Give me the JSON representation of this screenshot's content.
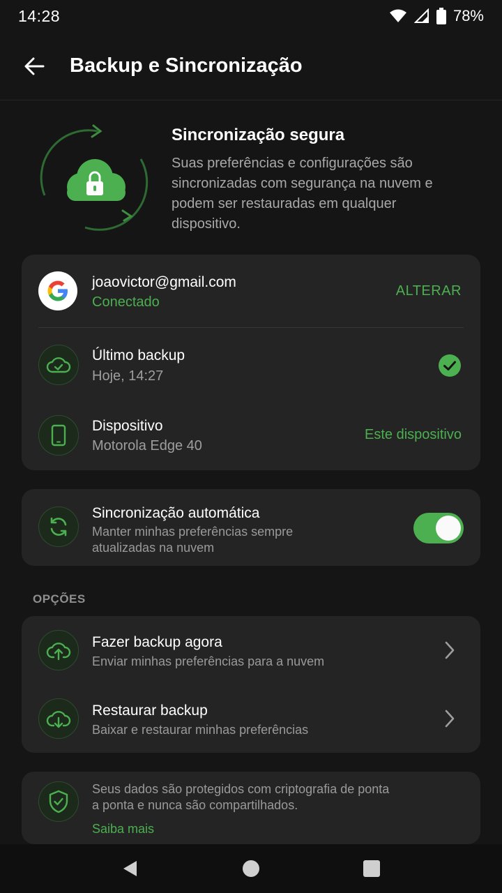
{
  "status_bar": {
    "time": "14:28",
    "battery": "78%",
    "icons": [
      "wifi-icon",
      "signal-icon",
      "battery-icon"
    ]
  },
  "app_bar": {
    "back_icon": "arrow-left-icon",
    "title": "Backup e Sincronização"
  },
  "hero": {
    "title": "Sincronização segura",
    "description": "Suas preferências e configurações são sincronizadas com segurança na nuvem e podem ser restauradas em qualquer dispositivo.",
    "icon": "cloud-lock-sync-icon"
  },
  "account_card": {
    "account": {
      "email": "joaovictor@gmail.com",
      "status": "Conectado",
      "action": "ALTERAR",
      "icon": "google-icon"
    },
    "last_backup": {
      "title": "Último backup",
      "value": "Hoje, 14:27",
      "icon": "cloud-check-icon",
      "status_icon": "check-circle-icon"
    },
    "device": {
      "title": "Dispositivo",
      "value": "Motorola Edge 40",
      "tag": "Este dispositivo",
      "icon": "smartphone-icon"
    }
  },
  "auto_sync": {
    "title": "Sincronização automática",
    "description_line1": "Manter minhas preferências sempre",
    "description_line2": "atualizadas na nuvem",
    "enabled": true,
    "icon": "sync-icon"
  },
  "options": {
    "section_label": "OPÇÕES",
    "items": [
      {
        "title": "Fazer backup agora",
        "subtitle": "Enviar minhas preferências para a nuvem",
        "icon": "cloud-upload-icon"
      },
      {
        "title": "Restaurar backup",
        "subtitle": "Baixar e restaurar minhas preferências",
        "icon": "cloud-download-icon"
      }
    ]
  },
  "security_note": {
    "line1": "Seus dados são protegidos com criptografia de ponta",
    "line2": "a ponta e nunca são compartilhados.",
    "link": "Saiba mais",
    "icon": "shield-check-icon"
  },
  "nav_bar": {
    "icons": [
      "nav-back-icon",
      "nav-home-icon",
      "nav-recents-icon"
    ]
  },
  "colors": {
    "background": "#151515",
    "card": "#242424",
    "accent": "#4caf50",
    "text_secondary": "#9e9e9e"
  }
}
